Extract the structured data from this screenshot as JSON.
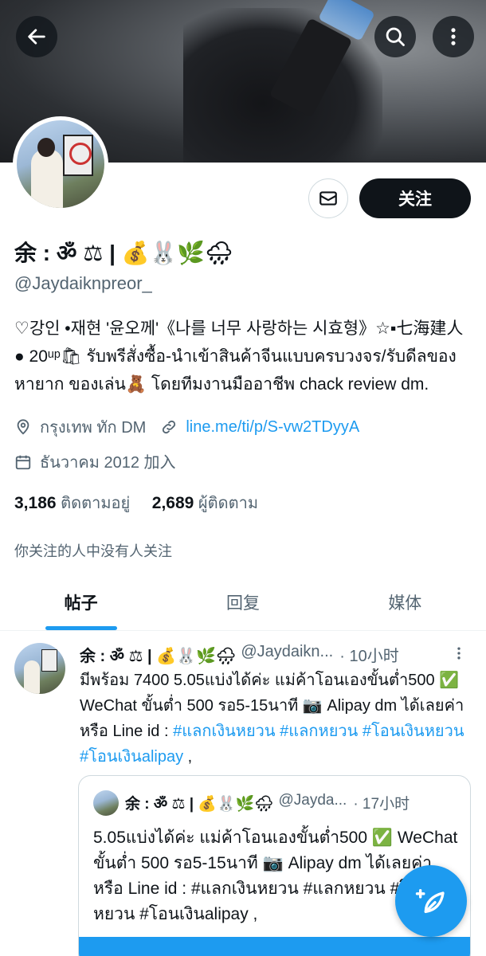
{
  "header": {
    "back_icon": "arrow-left-icon",
    "search_icon": "search-icon",
    "more_icon": "more-vertical-icon"
  },
  "profile": {
    "display_name": "余 : ॐ ⚖ | 💰🐰🌿🌧",
    "handle": "@Jaydaiknpreor_",
    "bio": "♡강인 •재현 '윤오께'《나를 너무 사랑하는 시효형》☆▪七海建人 ● 20ᵘᵖ🛍 รับพรีสั่งซื้อ-นำเข้าสินค้าจีนแบบครบวงจร/รับดีลของหายาก ของเล่น🧸 โดยทีมงานมืออาชีพ chack review dm.",
    "location": "กรุงเทพ ทัก DM",
    "link": "line.me/ti/p/S-vw2TDyyA",
    "joined": "ธันวาคม 2012 加入",
    "following_count": "3,186",
    "following_label": "ติดตามอยู่",
    "followers_count": "2,689",
    "followers_label": "ผู้ติดตาม",
    "not_followed_text": "你关注的人中没有人关注",
    "follow_label": "关注",
    "message_icon": "envelope-icon"
  },
  "tabs": [
    {
      "label": "帖子",
      "active": true
    },
    {
      "label": "回复",
      "active": false
    },
    {
      "label": "媒体",
      "active": false
    }
  ],
  "tweet": {
    "name": "余 : ॐ ⚖ | 💰🐰🌿🌧",
    "handle": "@Jaydaikn...",
    "time": "· 10小时",
    "text_plain": "มีพร้อม 7400 5.05แบ่งได้ค่ะ แม่ค้าโอนเองขั้นต่ำ500 ✅ WeChat ขั้นต่ำ 500 รอ5-15นาที 📷 Alipay  dm ได้เลยค่า หรือ Line id : ",
    "hashtag1": "#แลกเงินหยวน",
    "hashtag2": "#แลกหยวน",
    "hashtag3": "#โอนเงินหยวน",
    "hashtag4": "#โอนเงินalipay",
    "tail": " ,",
    "quote": {
      "name": "余 : ॐ ⚖ | 💰🐰🌿🌧",
      "handle": "@Jayda...",
      "time": "· 17小时",
      "text": "5.05แบ่งได้ค่ะ แม่ค้าโอนเองขั้นต่ำ500 ✅ WeChat ขั้นต่ำ 500 รอ5-15นาที 📷 Alipay dm ได้เลยค่า หรือ Line id : #แลกเงินหยวน #แลกหยวน #โอนเงินหยวน #โอนเงินalipay ,"
    }
  },
  "fab_icon": "compose-feather-icon",
  "colors": {
    "accent": "#1d9bf0",
    "text": "#0f1419",
    "secondary": "#536471"
  }
}
